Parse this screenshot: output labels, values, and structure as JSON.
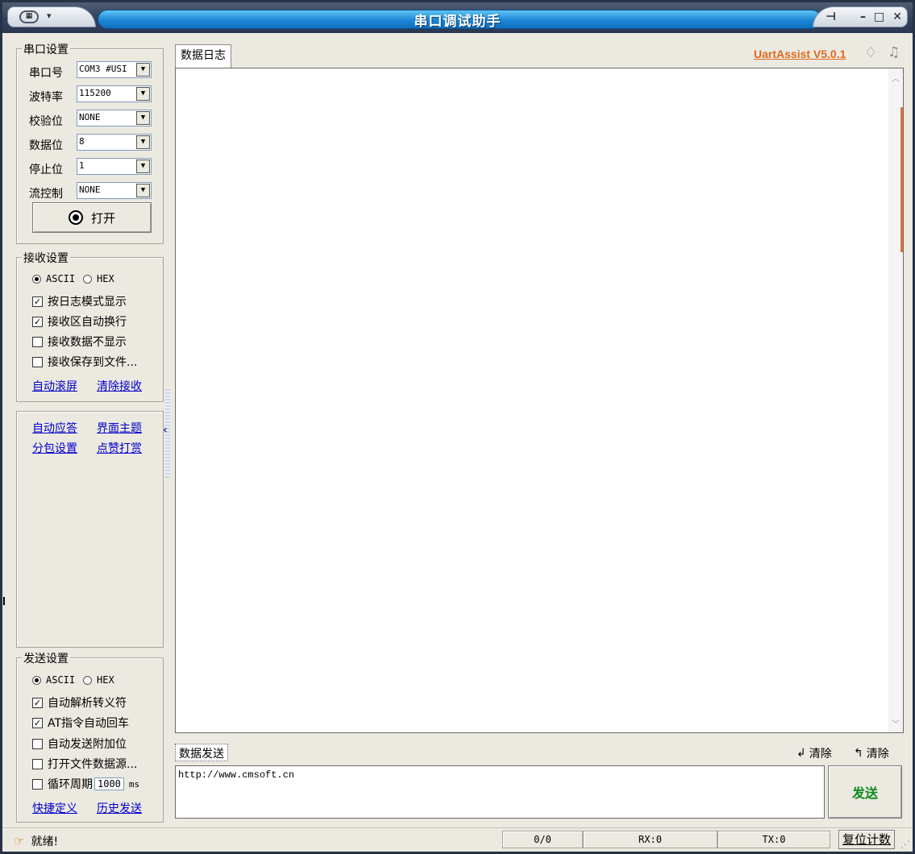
{
  "window": {
    "title": "串口调试助手"
  },
  "serial": {
    "group_title": "串口设置",
    "port_label": "串口号",
    "port_value": "COM3 #USI",
    "baud_label": "波特率",
    "baud_value": "115200",
    "parity_label": "校验位",
    "parity_value": "NONE",
    "databits_label": "数据位",
    "databits_value": "8",
    "stopbits_label": "停止位",
    "stopbits_value": "1",
    "flow_label": "流控制",
    "flow_value": "NONE",
    "open_label": "打开"
  },
  "receive": {
    "group_title": "接收设置",
    "ascii": "ASCII",
    "hex": "HEX",
    "log_mode": "按日志模式显示",
    "auto_wrap": "接收区自动换行",
    "hide_data": "接收数据不显示",
    "save_file": "接收保存到文件...",
    "auto_scroll": "自动滚屏",
    "clear_recv": "清除接收"
  },
  "links": {
    "auto_reply": "自动应答",
    "theme": "界面主题",
    "packet": "分包设置",
    "tip": "点赞打赏"
  },
  "send": {
    "group_title": "发送设置",
    "ascii": "ASCII",
    "hex": "HEX",
    "escape": "自动解析转义符",
    "at_cr": "AT指令自动回车",
    "append": "自动发送附加位",
    "open_file": "打开文件数据源...",
    "loop": "循环周期",
    "loop_value": "1000",
    "loop_unit": "ms",
    "shortcut": "快捷定义",
    "history": "历史发送"
  },
  "log": {
    "tab": "数据日志",
    "brand": "UartAssist V5.0.1"
  },
  "sendbox": {
    "tab": "数据发送",
    "clear1": "清除",
    "clear2": "清除",
    "text": "http://www.cmsoft.cn",
    "send_btn": "发送"
  },
  "status": {
    "ready": "就绪!",
    "count": "0/0",
    "rx": "RX:0",
    "tx": "TX:0",
    "reset": "复位计数"
  }
}
